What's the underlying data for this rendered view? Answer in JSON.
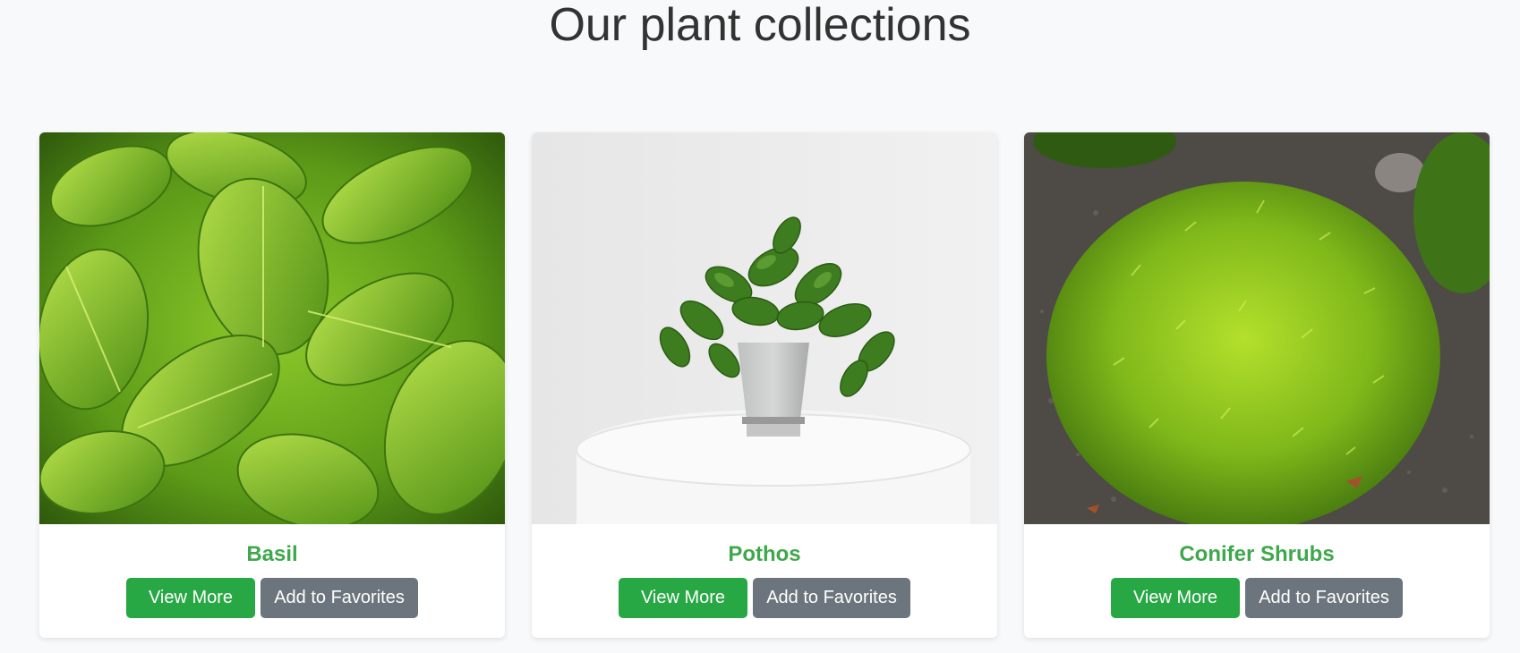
{
  "page": {
    "title": "Our plant collections"
  },
  "colors": {
    "title_text": "#333333",
    "card_title": "#3ea84b",
    "view_button_bg": "#28a745",
    "favorite_button_bg": "#6c757d"
  },
  "cards": [
    {
      "name": "Basil",
      "image_icon": "basil-plant-image",
      "view_label": "View More",
      "favorite_label": "Add to Favorites"
    },
    {
      "name": "Pothos",
      "image_icon": "pothos-plant-image",
      "view_label": "View More",
      "favorite_label": "Add to Favorites"
    },
    {
      "name": "Conifer Shrubs",
      "image_icon": "conifer-shrub-image",
      "view_label": "View More",
      "favorite_label": "Add to Favorites"
    }
  ]
}
